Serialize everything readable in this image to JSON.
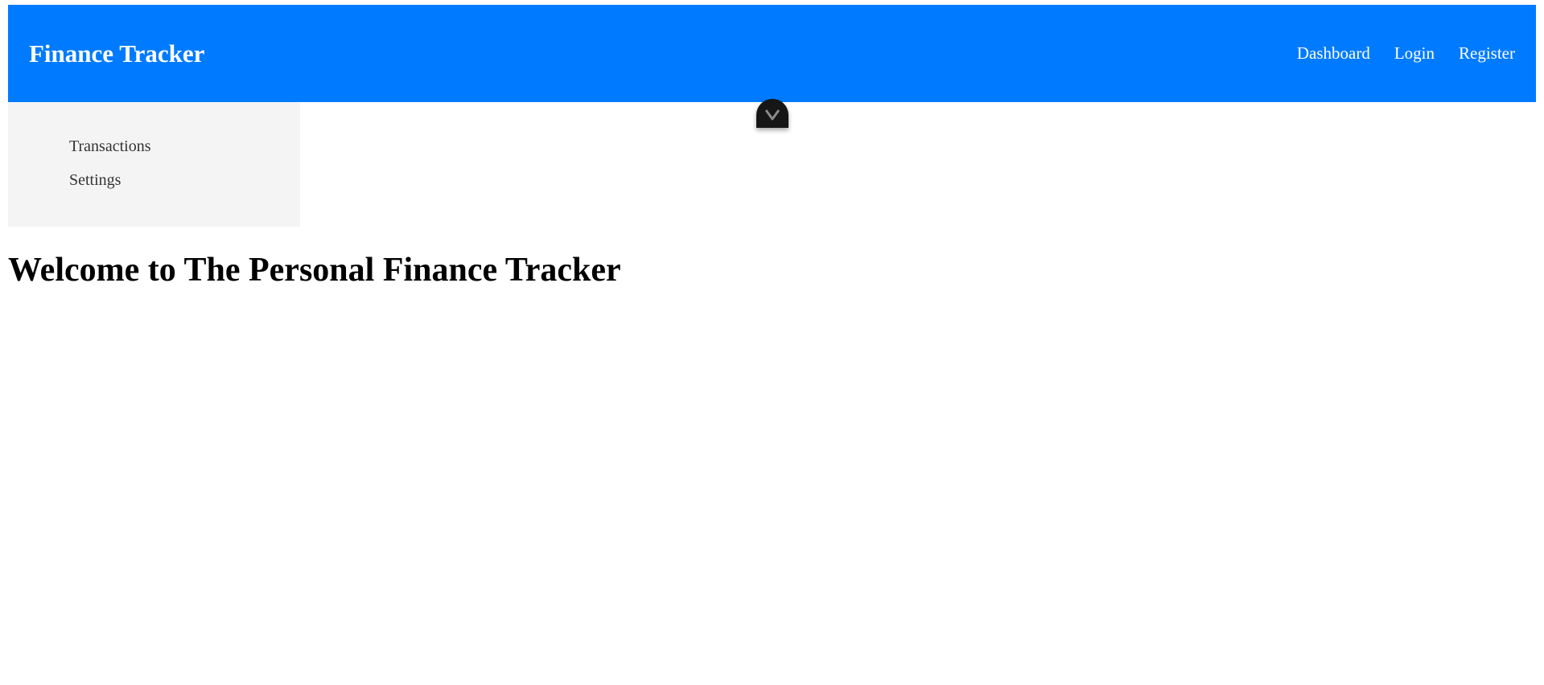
{
  "header": {
    "brand": "Finance Tracker",
    "nav": [
      "Dashboard",
      "Login",
      "Register"
    ],
    "background_color": "#007bff"
  },
  "sidebar": {
    "items": [
      "Transactions",
      "Settings"
    ],
    "background_color": "#f4f4f4"
  },
  "main": {
    "heading": "Welcome to The Personal Finance Tracker"
  },
  "devtools_toggle": {
    "icon": "chevron-down-icon"
  }
}
